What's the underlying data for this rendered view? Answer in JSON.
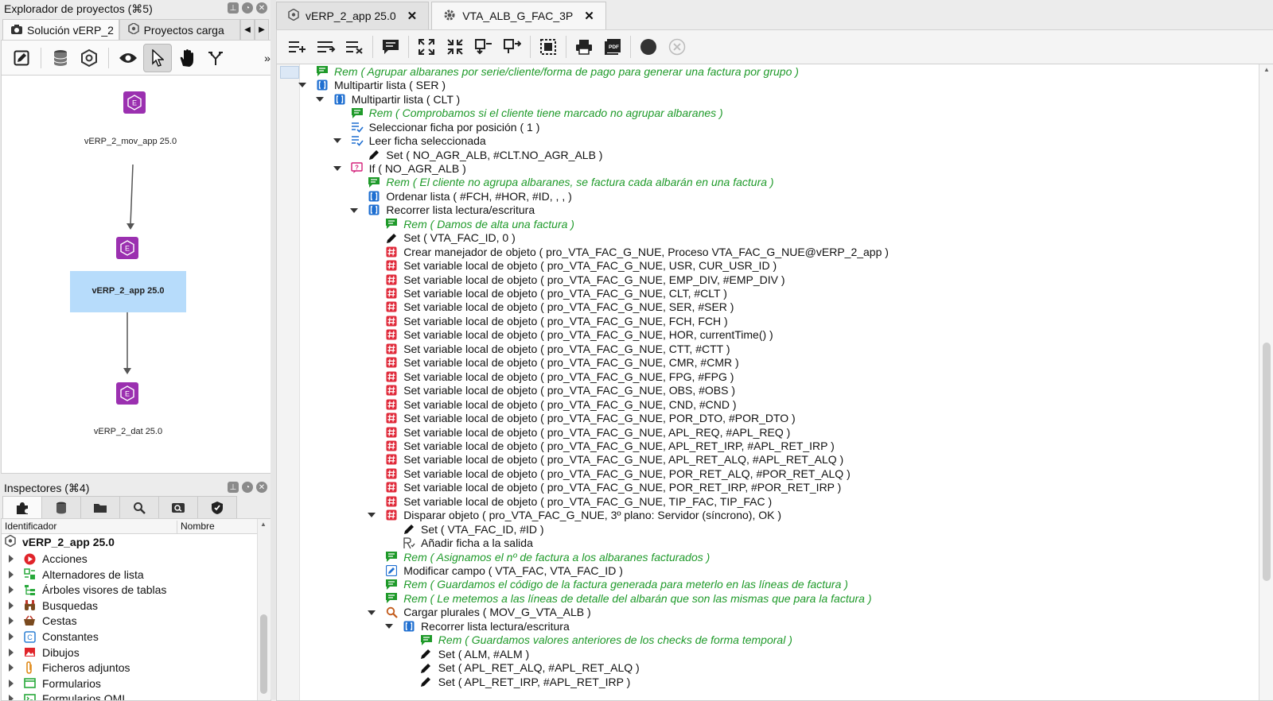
{
  "project_panel": {
    "title": "Explorador de proyectos (⌘5)",
    "tabs": [
      {
        "label": "Solución vERP_2",
        "icon": "camera-icon",
        "active": true
      },
      {
        "label": "Proyectos carga",
        "icon": "hexagon-gear-icon",
        "active": false
      }
    ],
    "toolbar_icons": [
      "edit-icon",
      "database-icon",
      "hexagon-gear-icon",
      "eye-icon",
      "pointer-icon",
      "hand-icon",
      "fork-icon",
      "more-icon"
    ],
    "nodes": [
      {
        "label": "vERP_2_mov_app 25.0"
      },
      {
        "label": "vERP_2_app 25.0",
        "selected": true
      },
      {
        "label": "vERP_2_dat 25.0"
      }
    ]
  },
  "inspector_panel": {
    "title": "Inspectores (⌘4)",
    "tab_icons": [
      "puzzle-icon",
      "database-icon",
      "folder-icon",
      "search-plus-icon",
      "search-window-icon",
      "shield-icon"
    ],
    "columns": [
      "Identificador",
      "Nombre"
    ],
    "root": "vERP_2_app 25.0",
    "items": [
      {
        "label": "Acciones",
        "icon": "play-icon",
        "color": "#e0242a"
      },
      {
        "label": "Alternadores de lista",
        "icon": "list-toggle-icon",
        "color": "#27a83a"
      },
      {
        "label": "Árboles visores de tablas",
        "icon": "tree-icon",
        "color": "#27a83a"
      },
      {
        "label": "Busquedas",
        "icon": "binoculars-icon",
        "color": "#7a4a1e"
      },
      {
        "label": "Cestas",
        "icon": "basket-icon",
        "color": "#7a4a1e"
      },
      {
        "label": "Constantes",
        "icon": "constant-icon",
        "color": "#2a7fd4"
      },
      {
        "label": "Dibujos",
        "icon": "image-icon",
        "color": "#e0242a"
      },
      {
        "label": "Ficheros adjuntos",
        "icon": "paperclip-icon",
        "color": "#e08a1a"
      },
      {
        "label": "Formularios",
        "icon": "form-icon",
        "color": "#27a83a"
      },
      {
        "label": "Formularios QML",
        "icon": "qml-icon",
        "color": "#27a83a"
      }
    ]
  },
  "editor": {
    "tabs": [
      {
        "label": "vERP_2_app 25.0",
        "icon": "hexagon-gear-icon",
        "active": false
      },
      {
        "label": "VTA_ALB_G_FAC_3P",
        "icon": "gear-icon",
        "active": true
      }
    ],
    "toolbar_icons": [
      "add-line-icon",
      "insert-line-icon",
      "delete-line-icon",
      "comment-icon",
      "expand-all-icon",
      "collapse-all-icon",
      "move-in-icon",
      "move-out-icon",
      "select-block-icon",
      "print-icon",
      "pdf-icon",
      "record-icon",
      "stop-icon"
    ],
    "lines": [
      {
        "indent": 0,
        "icon": "rem",
        "text": "Rem ( Agrupar albaranes por serie/cliente/forma de pago para generar una factura por grupo )",
        "expand": false
      },
      {
        "indent": 0,
        "icon": "list",
        "text": "Multipartir lista ( SER )",
        "expand": true
      },
      {
        "indent": 1,
        "icon": "list",
        "text": "Multipartir lista ( CLT )",
        "expand": true
      },
      {
        "indent": 2,
        "icon": "rem",
        "text": "Rem ( Comprobamos si el cliente tiene marcado no agrupar albaranes )",
        "expand": false
      },
      {
        "indent": 2,
        "icon": "select",
        "text": "Seleccionar ficha por posición ( 1 )",
        "expand": false
      },
      {
        "indent": 2,
        "icon": "select",
        "text": "Leer ficha seleccionada",
        "expand": true
      },
      {
        "indent": 3,
        "icon": "set",
        "text": "Set ( NO_AGR_ALB, #CLT.NO_AGR_ALB )",
        "expand": false
      },
      {
        "indent": 2,
        "icon": "if",
        "text": "If ( NO_AGR_ALB )",
        "expand": true
      },
      {
        "indent": 3,
        "icon": "rem",
        "text": "Rem ( El cliente no agrupa albaranes, se factura cada albarán en una factura )",
        "expand": false
      },
      {
        "indent": 3,
        "icon": "list",
        "text": "Ordenar lista ( #FCH, #HOR, #ID, , ,  )",
        "expand": false
      },
      {
        "indent": 3,
        "icon": "list",
        "text": "Recorrer lista lectura/escritura",
        "expand": true
      },
      {
        "indent": 4,
        "icon": "rem",
        "text": "Rem ( Damos de alta una factura )",
        "expand": false
      },
      {
        "indent": 4,
        "icon": "set",
        "text": "Set ( VTA_FAC_ID, 0 )",
        "expand": false
      },
      {
        "indent": 4,
        "icon": "hash",
        "text": "Crear manejador de objeto ( pro_VTA_FAC_G_NUE, Proceso VTA_FAC_G_NUE@vERP_2_app )",
        "expand": false
      },
      {
        "indent": 4,
        "icon": "hash",
        "text": "Set variable local de objeto ( pro_VTA_FAC_G_NUE, USR, CUR_USR_ID )",
        "expand": false
      },
      {
        "indent": 4,
        "icon": "hash",
        "text": "Set variable local de objeto ( pro_VTA_FAC_G_NUE, EMP_DIV, #EMP_DIV )",
        "expand": false
      },
      {
        "indent": 4,
        "icon": "hash",
        "text": "Set variable local de objeto ( pro_VTA_FAC_G_NUE, CLT, #CLT )",
        "expand": false
      },
      {
        "indent": 4,
        "icon": "hash",
        "text": "Set variable local de objeto ( pro_VTA_FAC_G_NUE, SER, #SER )",
        "expand": false
      },
      {
        "indent": 4,
        "icon": "hash",
        "text": "Set variable local de objeto ( pro_VTA_FAC_G_NUE, FCH, FCH )",
        "expand": false
      },
      {
        "indent": 4,
        "icon": "hash",
        "text": "Set variable local de objeto ( pro_VTA_FAC_G_NUE, HOR, currentTime() )",
        "expand": false
      },
      {
        "indent": 4,
        "icon": "hash",
        "text": "Set variable local de objeto ( pro_VTA_FAC_G_NUE, CTT, #CTT )",
        "expand": false
      },
      {
        "indent": 4,
        "icon": "hash",
        "text": "Set variable local de objeto ( pro_VTA_FAC_G_NUE, CMR, #CMR )",
        "expand": false
      },
      {
        "indent": 4,
        "icon": "hash",
        "text": "Set variable local de objeto ( pro_VTA_FAC_G_NUE, FPG, #FPG )",
        "expand": false
      },
      {
        "indent": 4,
        "icon": "hash",
        "text": "Set variable local de objeto ( pro_VTA_FAC_G_NUE, OBS, #OBS )",
        "expand": false
      },
      {
        "indent": 4,
        "icon": "hash",
        "text": "Set variable local de objeto ( pro_VTA_FAC_G_NUE, CND, #CND )",
        "expand": false
      },
      {
        "indent": 4,
        "icon": "hash",
        "text": "Set variable local de objeto ( pro_VTA_FAC_G_NUE, POR_DTO, #POR_DTO )",
        "expand": false
      },
      {
        "indent": 4,
        "icon": "hash",
        "text": "Set variable local de objeto ( pro_VTA_FAC_G_NUE, APL_REQ, #APL_REQ )",
        "expand": false
      },
      {
        "indent": 4,
        "icon": "hash",
        "text": "Set variable local de objeto ( pro_VTA_FAC_G_NUE, APL_RET_IRP, #APL_RET_IRP )",
        "expand": false
      },
      {
        "indent": 4,
        "icon": "hash",
        "text": "Set variable local de objeto ( pro_VTA_FAC_G_NUE, APL_RET_ALQ, #APL_RET_ALQ )",
        "expand": false
      },
      {
        "indent": 4,
        "icon": "hash",
        "text": "Set variable local de objeto ( pro_VTA_FAC_G_NUE, POR_RET_ALQ, #POR_RET_ALQ )",
        "expand": false
      },
      {
        "indent": 4,
        "icon": "hash",
        "text": "Set variable local de objeto ( pro_VTA_FAC_G_NUE, POR_RET_IRP, #POR_RET_IRP )",
        "expand": false
      },
      {
        "indent": 4,
        "icon": "hash",
        "text": "Set variable local de objeto ( pro_VTA_FAC_G_NUE, TIP_FAC, TIP_FAC )",
        "expand": false
      },
      {
        "indent": 4,
        "icon": "hash",
        "text": "Disparar objeto ( pro_VTA_FAC_G_NUE, 3º plano: Servidor (síncrono), OK )",
        "expand": true
      },
      {
        "indent": 5,
        "icon": "set",
        "text": "Set ( VTA_FAC_ID, #ID )",
        "expand": false
      },
      {
        "indent": 5,
        "icon": "add",
        "text": "Añadir ficha a la salida",
        "expand": false
      },
      {
        "indent": 4,
        "icon": "rem",
        "text": "Rem ( Asignamos el nº de factura a los albaranes facturados )",
        "expand": false
      },
      {
        "indent": 4,
        "icon": "modify",
        "text": "Modificar campo ( VTA_FAC, VTA_FAC_ID )",
        "expand": false
      },
      {
        "indent": 4,
        "icon": "rem",
        "text": "Rem ( Guardamos el código de la factura generada para meterlo en las líneas de factura )",
        "expand": false
      },
      {
        "indent": 4,
        "icon": "rem",
        "text": "Rem ( Le metemos a las líneas de detalle del albarán que son las mismas que para la factura )",
        "expand": false
      },
      {
        "indent": 4,
        "icon": "search",
        "text": "Cargar plurales ( MOV_G_VTA_ALB )",
        "expand": true
      },
      {
        "indent": 5,
        "icon": "list",
        "text": "Recorrer lista lectura/escritura",
        "expand": true
      },
      {
        "indent": 6,
        "icon": "rem",
        "text": "Rem ( Guardamos valores anteriores de los checks de forma temporal )",
        "expand": false
      },
      {
        "indent": 6,
        "icon": "set",
        "text": "Set ( ALM, #ALM )",
        "expand": false
      },
      {
        "indent": 6,
        "icon": "set",
        "text": "Set ( APL_RET_ALQ, #APL_RET_ALQ )",
        "expand": false
      },
      {
        "indent": 6,
        "icon": "set",
        "text": "Set ( APL_RET_IRP, #APL_RET_IRP )",
        "expand": false
      }
    ]
  }
}
